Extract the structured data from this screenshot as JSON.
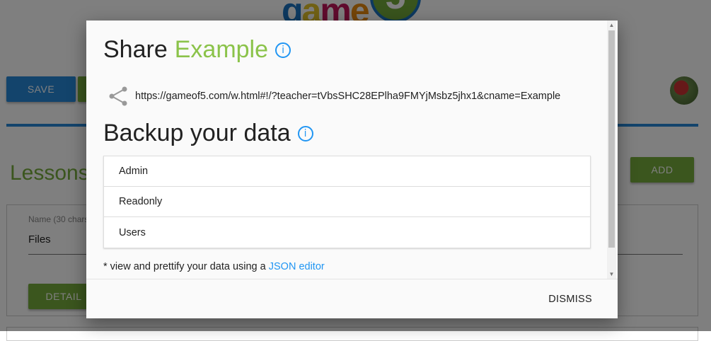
{
  "background": {
    "logo_text": [
      "g",
      "a",
      "m",
      "e"
    ],
    "logo_number": "5",
    "save_label": "SAVE",
    "add_label": "ADD",
    "lessons_title": "Lessons",
    "name_label": "Name (30 chars",
    "name_value": "Files",
    "detail_label": "DETAIL"
  },
  "modal": {
    "title_prefix": "Share",
    "title_name": "Example",
    "info_glyph": "i",
    "share_url": "https://gameof5.com/w.html#!/?teacher=tVbsSHC28EPlha9FMYjMsbz5jhx1&cname=Example",
    "backup_title": "Backup your data",
    "backup_items": [
      {
        "label": "Admin"
      },
      {
        "label": "Readonly"
      },
      {
        "label": "Users"
      }
    ],
    "note_prefix": "* view and prettify your data using a ",
    "note_link": "JSON editor",
    "dismiss_label": "DISMISS"
  },
  "colors": {
    "accent_green": "#8bc34a",
    "link_blue": "#2196f3",
    "primary_blue": "#2688d8"
  }
}
